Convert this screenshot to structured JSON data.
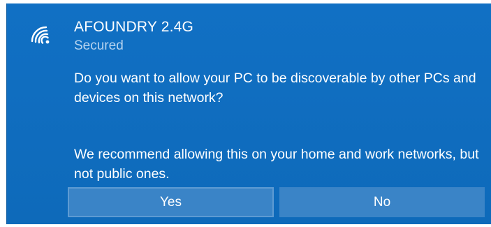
{
  "network": {
    "name": "AFOUNDRY 2.4G",
    "status": "Secured",
    "icon": "wifi-icon"
  },
  "prompt": {
    "question": "Do you want to allow your PC to be discoverable by other PCs and devices on this network?",
    "recommendation": "We recommend allowing this on your home and work networks, but not public ones."
  },
  "buttons": {
    "yes_label": "Yes",
    "no_label": "No"
  },
  "colors": {
    "panel_background": "#0f6cbd",
    "button_background": "#3a84c7",
    "status_text": "#b7d4ef",
    "text": "#ffffff"
  }
}
